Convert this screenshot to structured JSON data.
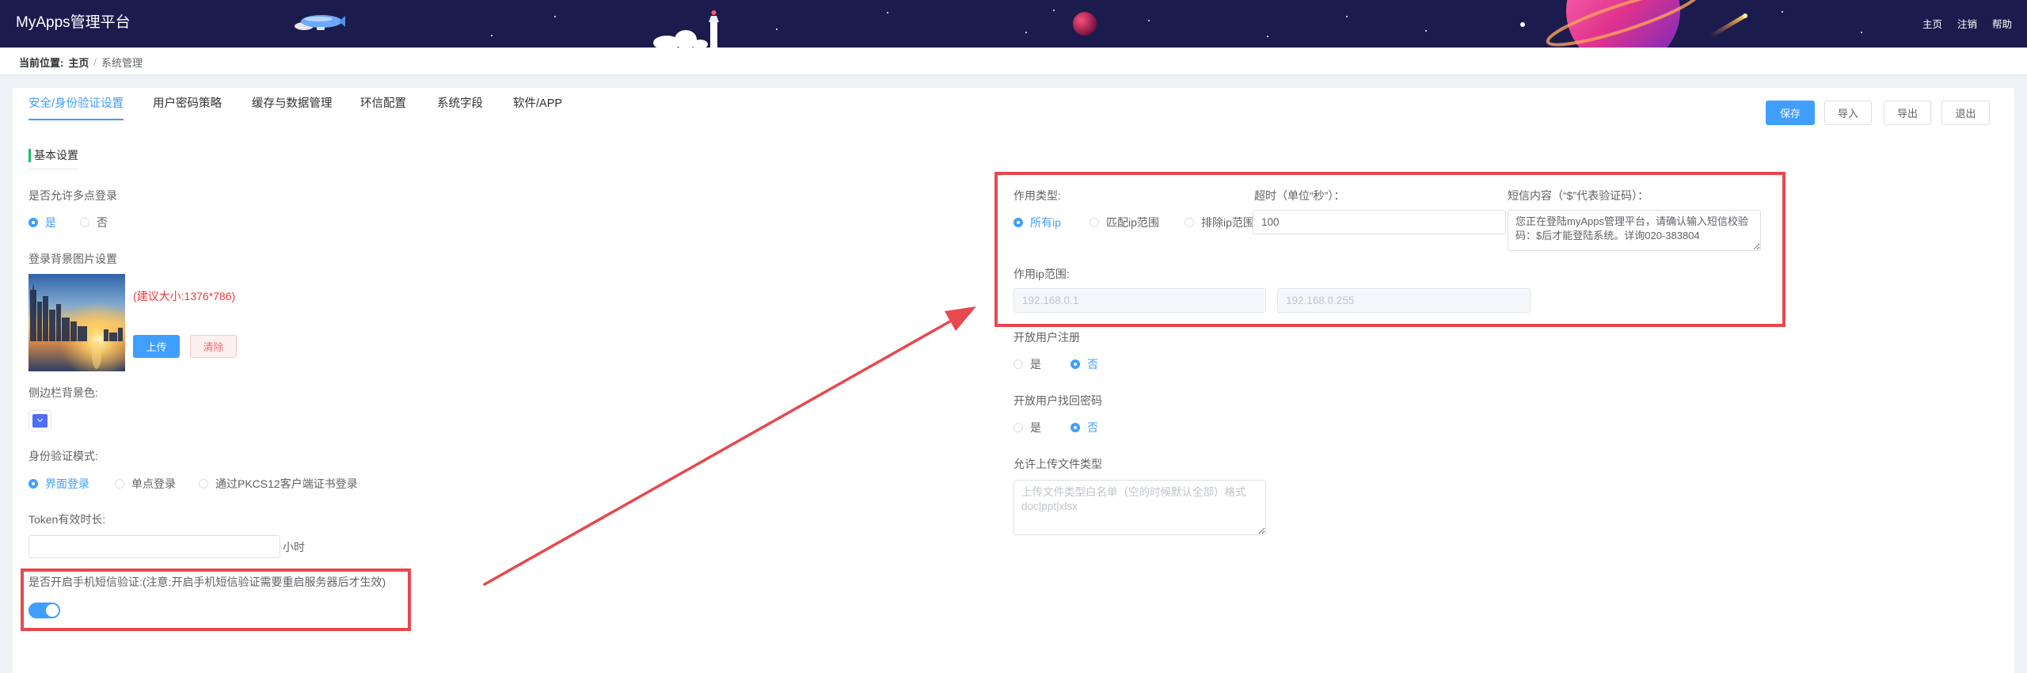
{
  "header": {
    "title": "MyApps管理平台",
    "nav": {
      "home": "主页",
      "logout": "注销",
      "help": "帮助"
    }
  },
  "breadcrumb": {
    "prefix": "当前位置:",
    "home": "主页",
    "separator": "/",
    "current": "系统管理"
  },
  "tabs": {
    "items": [
      "安全/身份验证设置",
      "用户密码策略",
      "缓存与数据管理",
      "环信配置",
      "系统字段",
      "软件/APP"
    ],
    "active": "安全/身份验证设置"
  },
  "toolbar": {
    "save": "保存",
    "import": "导入",
    "export": "导出",
    "exit": "退出"
  },
  "section": {
    "title": "基本设置"
  },
  "left": {
    "multi_login": {
      "label": "是否允许多点登录",
      "options": [
        "是",
        "否"
      ],
      "selected": "是"
    },
    "bg_image": {
      "label": "登录背景图片设置",
      "hint": "(建议大小:1376*786)",
      "upload": "上传",
      "clear": "清除"
    },
    "sidebar_color": {
      "label": "侧边栏背景色:"
    },
    "auth_mode": {
      "label": "身份验证模式:",
      "options": [
        "界面登录",
        "单点登录",
        "通过PKCS12客户端证书登录"
      ],
      "selected": "界面登录"
    },
    "token": {
      "label": "Token有效时长:",
      "value": "",
      "unit": "小时"
    },
    "sms": {
      "label": "是否开启手机短信验证:(注意:开启手机短信验证需要重启服务器后才生效)",
      "enabled": true
    }
  },
  "right": {
    "scope_type": {
      "label": "作用类型:",
      "options": [
        "所有ip",
        "匹配ip范围",
        "排除ip范围"
      ],
      "selected": "所有ip"
    },
    "timeout": {
      "label": "超时（单位“秒”）：",
      "value": "100"
    },
    "sms_content": {
      "label": "短信内容（“$”代表验证码）：",
      "value": "您正在登陆myApps管理平台，请确认输入短信校验码：$后才能登陆系统。详询020-383804"
    },
    "ip_range": {
      "label": "作用ip范围:",
      "start": "192.168.0.1",
      "end": "192.168.0.255"
    },
    "open_register": {
      "label": "开放用户注册",
      "options": [
        "是",
        "否"
      ],
      "selected": "否"
    },
    "open_recover": {
      "label": "开放用户找回密码",
      "options": [
        "是",
        "否"
      ],
      "selected": "否"
    },
    "upload_types": {
      "label": "允许上传文件类型",
      "value": "",
      "placeholder": "上传文件类型白名单（空的时候默认全部）格式doc|ppt|xlsx"
    }
  },
  "icons": {
    "color_picker": "chevron-down-icon"
  },
  "colors": {
    "header_bg": "#1c1b4d",
    "primary": "#409eff",
    "danger": "#f56c6c",
    "hint_red": "#f0383e",
    "annotation": "#e8484e",
    "section_bar": "#19be6b",
    "sidebar_swatch": "#4f6ef7"
  }
}
